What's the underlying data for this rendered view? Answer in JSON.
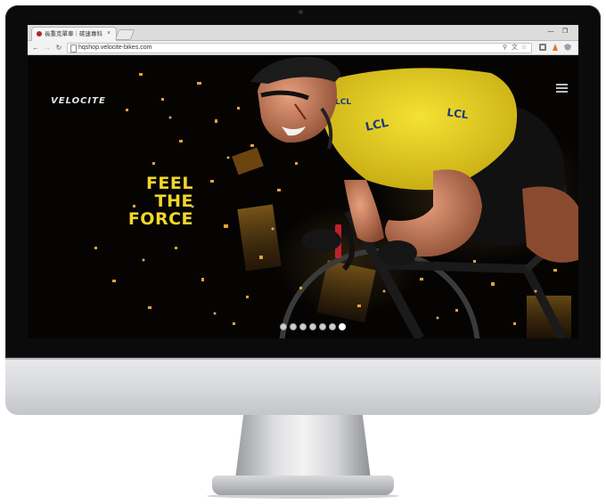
{
  "browser": {
    "tab_title": "長重克單車｜碳速專科",
    "tab_close": "×",
    "url": "hqshop.velocite-bikes.com",
    "window_minimize": "—",
    "window_maximize": "❐"
  },
  "site": {
    "logo_text": "VELOCITE",
    "tagline": [
      "FEEL",
      "THE",
      "FORCE"
    ],
    "accent_color": "#f1d72b",
    "jersey_text": "LCL"
  },
  "carousel": {
    "slide_count": 7,
    "active_index": 6
  },
  "icons": {
    "back": "←",
    "forward": "→",
    "reload": "↻",
    "zoom": "⚲",
    "translate": "文",
    "bookmark": "☆"
  }
}
